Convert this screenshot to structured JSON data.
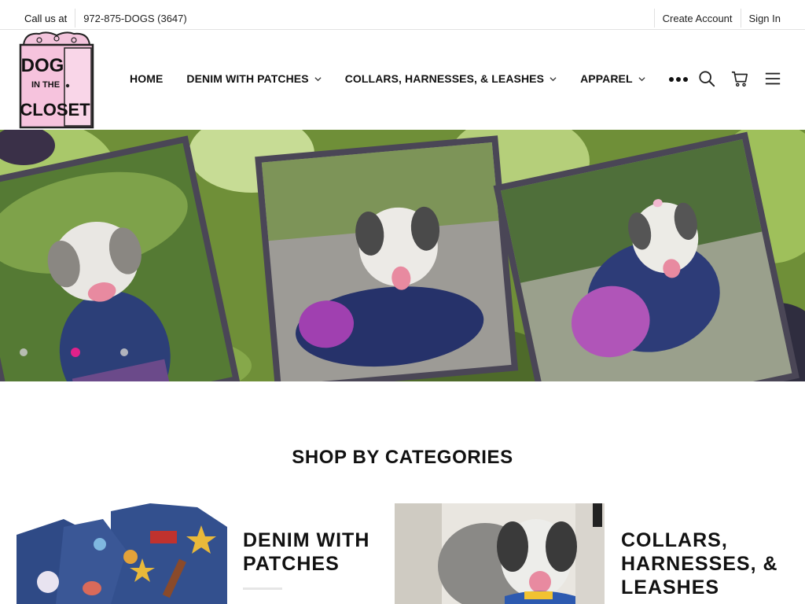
{
  "topbar": {
    "call_label": "Call us at",
    "phone": "972-875-DOGS (3647)",
    "create_account": "Create Account",
    "sign_in": "Sign In"
  },
  "logo": {
    "line1": "DOG",
    "line2": "IN THE",
    "line3": "CLOSET"
  },
  "nav": {
    "items": [
      {
        "label": "HOME",
        "has_dropdown": false
      },
      {
        "label": "DENIM WITH PATCHES",
        "has_dropdown": true
      },
      {
        "label": "COLLARS, HARNESSES, & LEASHES",
        "has_dropdown": true
      },
      {
        "label": "APPAREL",
        "has_dropdown": true
      }
    ],
    "more_icon": "more-dots-icon"
  },
  "header_icons": [
    "search-icon",
    "cart-icon",
    "menu-icon"
  ],
  "hero": {
    "slide_count": 3,
    "active_slide": 2,
    "accent_color": "#e0218a"
  },
  "categories": {
    "title": "SHOP BY CATEGORIES",
    "items": [
      {
        "line1": "DENIM WITH",
        "line2": "PATCHES",
        "line3": ""
      },
      {
        "line1": "COLLARS,",
        "line2": "HARNESSES, &",
        "line3": "LEASHES"
      }
    ]
  }
}
